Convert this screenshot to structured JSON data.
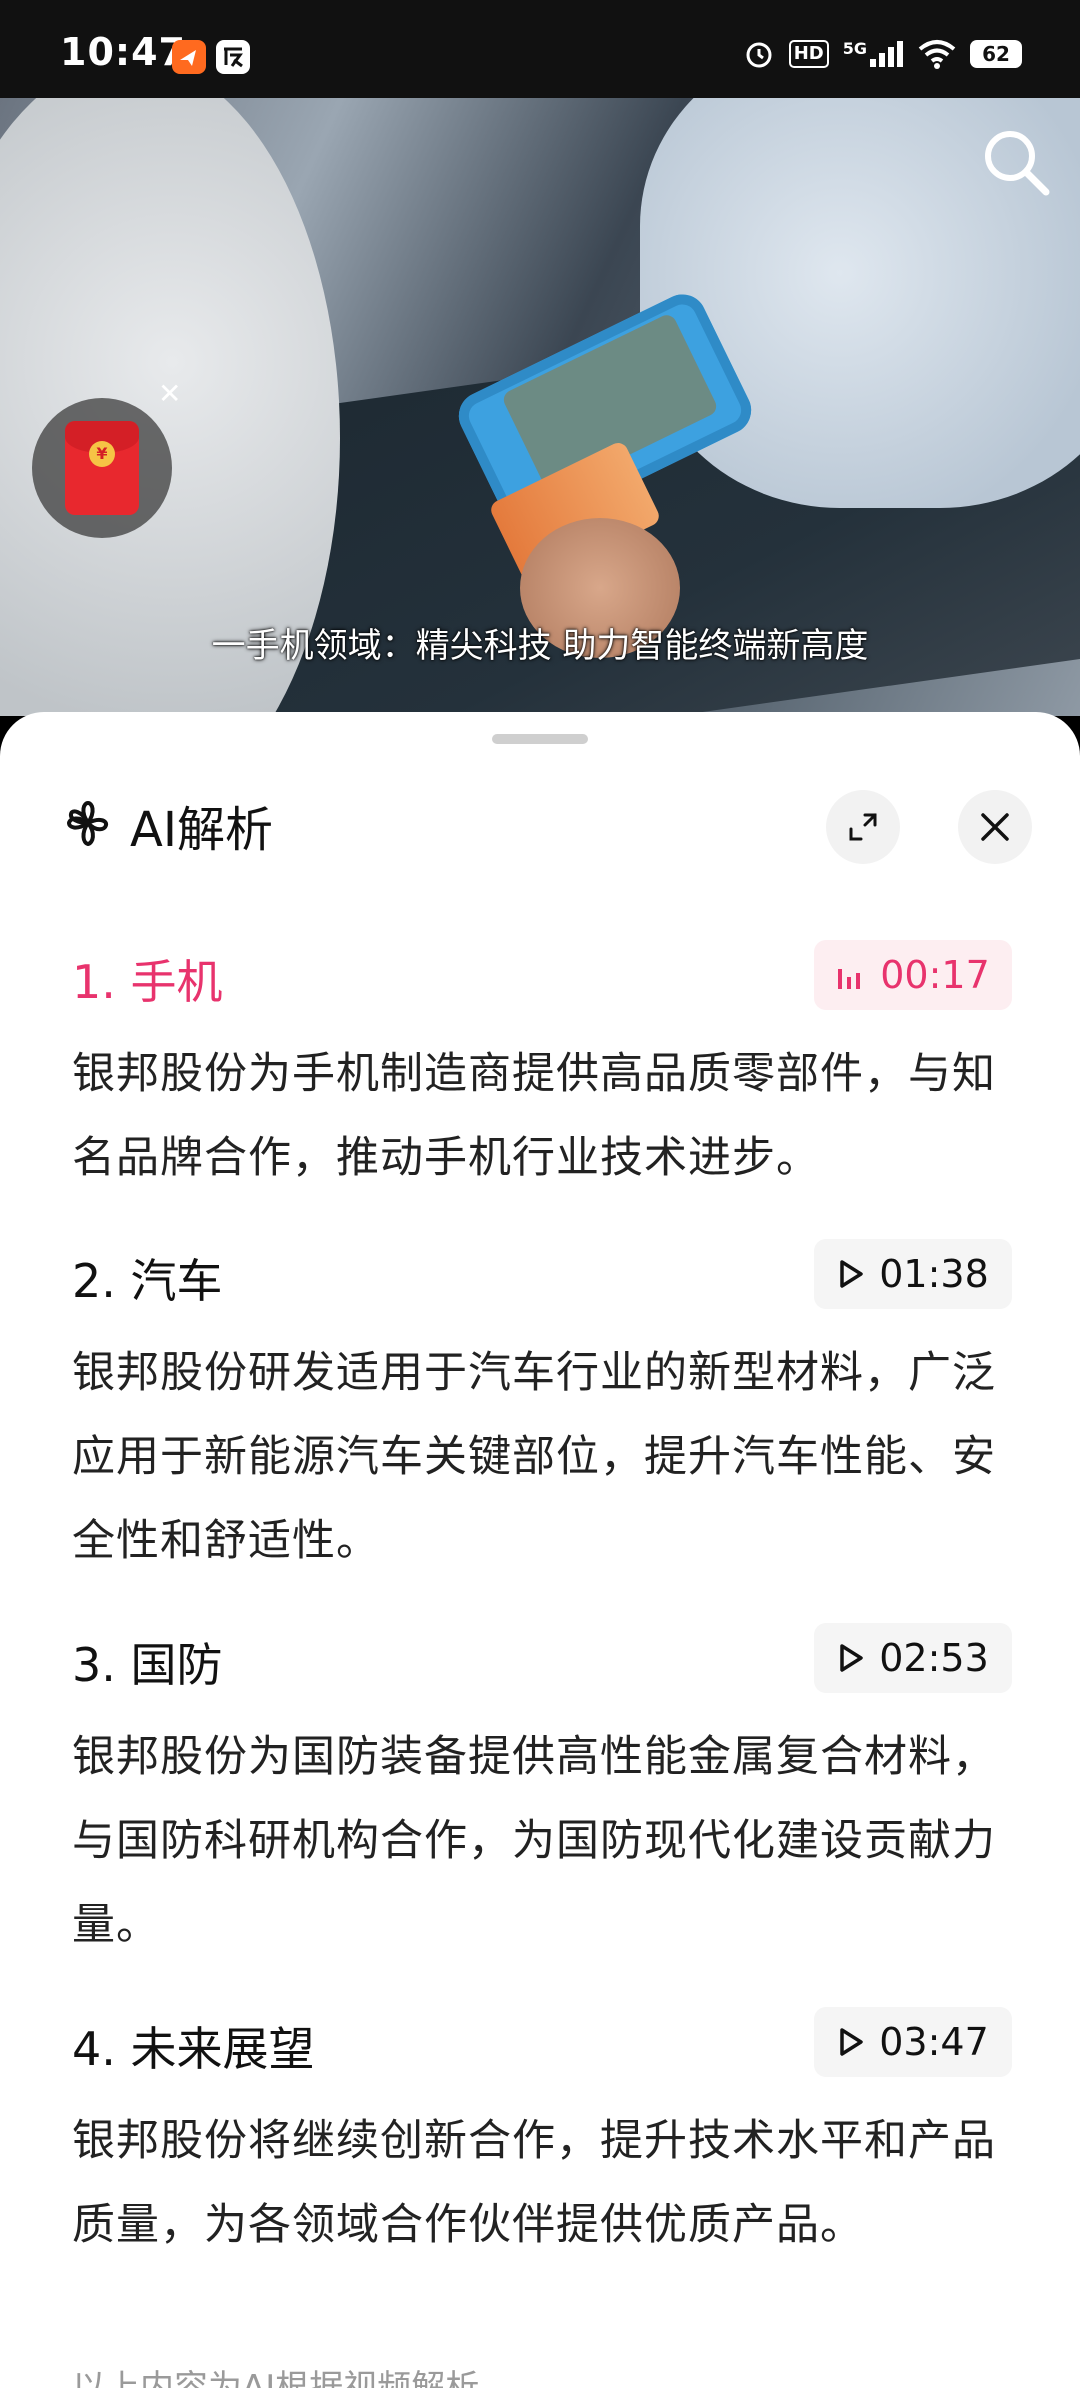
{
  "status_bar": {
    "time": "10:47",
    "network": "5G",
    "hd": "HD",
    "battery": "62"
  },
  "video": {
    "subtitle": "一手机领域：精尖科技 助力智能终端新高度"
  },
  "sheet": {
    "title": "AI解析",
    "sections": [
      {
        "title": "1. 手机",
        "time": "00:17",
        "body": "银邦股份为手机制造商提供高品质零部件，与知名品牌合作，推动手机行业技术进步。"
      },
      {
        "title": "2. 汽车",
        "time": "01:38",
        "body": "银邦股份研发适用于汽车行业的新型材料，广泛应用于新能源汽车关键部位，提升汽车性能、安全性和舒适性。"
      },
      {
        "title": "3. 国防",
        "time": "02:53",
        "body": "银邦股份为国防装备提供高性能金属复合材料，与国防科研机构合作，为国防现代化建设贡献力量。"
      },
      {
        "title": "4. 未来展望",
        "time": "03:47",
        "body": "银邦股份将继续创新合作，提升技术水平和产品质量，为各领域合作伙伴提供优质产品。"
      }
    ],
    "footnote": "以上内容为AI根据视频解析"
  },
  "colors": {
    "accent": "#e8336d",
    "active_chip_bg": "#fdeef1"
  }
}
